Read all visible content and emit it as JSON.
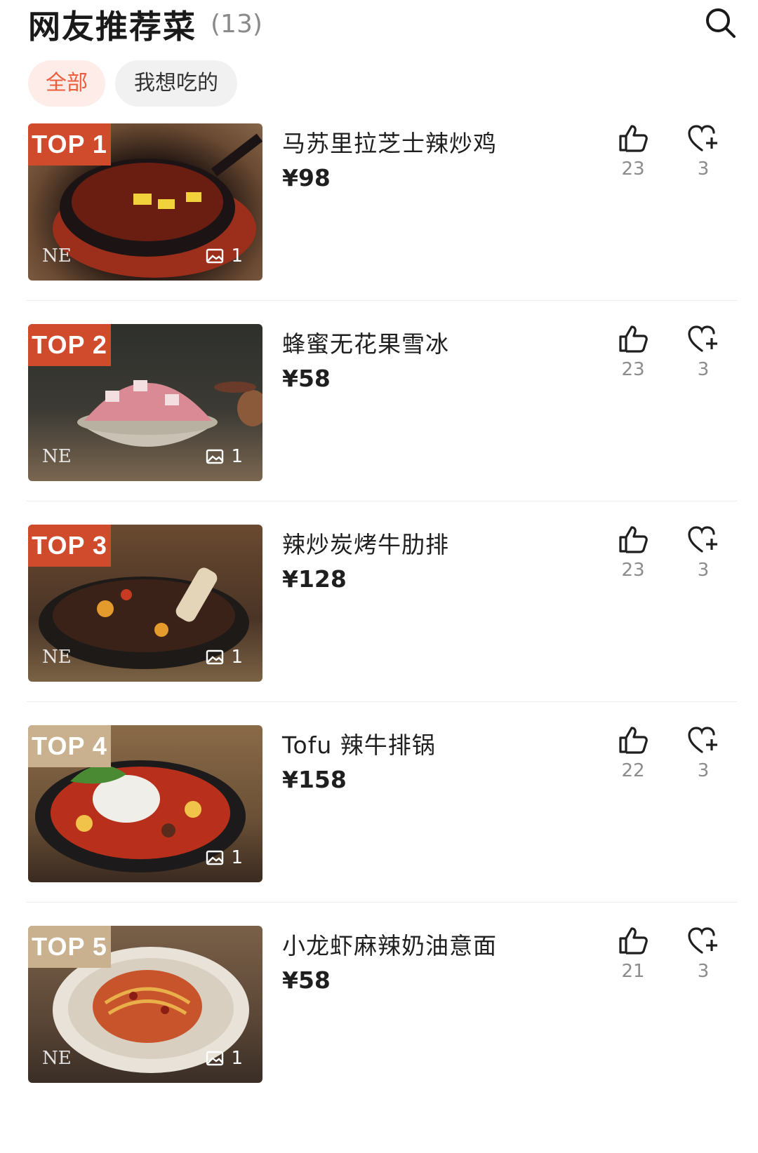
{
  "header": {
    "title": "网友推荐菜",
    "count": "(13)",
    "search_icon": "search-icon"
  },
  "filters": [
    {
      "label": "全部",
      "active": true
    },
    {
      "label": "我想吃的",
      "active": false
    }
  ],
  "colors": {
    "accent": "#ec5d3c",
    "rank_red": "#d04a2c",
    "rank_tan": "#c9b08e"
  },
  "dishes": [
    {
      "rank": "TOP 1",
      "name": "马苏里拉芝士辣炒鸡",
      "price": "¥98",
      "photos": "1",
      "likes": "23",
      "favorites": "3",
      "logo": "NE"
    },
    {
      "rank": "TOP 2",
      "name": "蜂蜜无花果雪冰",
      "price": "¥58",
      "photos": "1",
      "likes": "23",
      "favorites": "3",
      "logo": "NE"
    },
    {
      "rank": "TOP 3",
      "name": "辣炒炭烤牛肋排",
      "price": "¥128",
      "photos": "1",
      "likes": "23",
      "favorites": "3",
      "logo": "NE"
    },
    {
      "rank": "TOP 4",
      "name": "Tofu 辣牛排锅",
      "price": "¥158",
      "photos": "1",
      "likes": "22",
      "favorites": "3",
      "logo": ""
    },
    {
      "rank": "TOP 5",
      "name": "小龙虾麻辣奶油意面",
      "price": "¥58",
      "photos": "1",
      "likes": "21",
      "favorites": "3",
      "logo": "NE"
    }
  ]
}
